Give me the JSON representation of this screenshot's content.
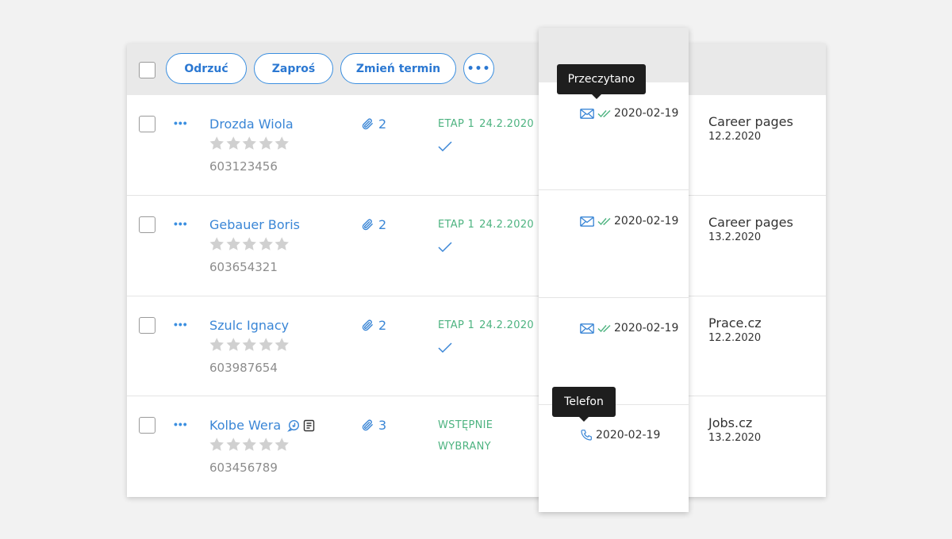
{
  "toolbar": {
    "buttons": [
      {
        "label": "Odrzuć"
      },
      {
        "label": "Zaproś"
      },
      {
        "label": "Zmień termin"
      }
    ],
    "more_label": "•••"
  },
  "row_menu_label": "•••",
  "rows": [
    {
      "name": "Drozda Wiola",
      "rating": 0,
      "phone": "603123456",
      "attachments": "2",
      "stage": "ETAP 1",
      "stage_date": "24.2.2020",
      "stage_line2": "",
      "contact_date": "2020-02-19",
      "contact_type": "email-read",
      "source": "Career pages",
      "source_date": "12.2.2020"
    },
    {
      "name": "Gebauer Boris",
      "rating": 0,
      "phone": "603654321",
      "attachments": "2",
      "stage": "ETAP 1",
      "stage_date": "24.2.2020",
      "stage_line2": "",
      "contact_date": "2020-02-19",
      "contact_type": "email-read",
      "source": "Career pages",
      "source_date": "13.2.2020"
    },
    {
      "name": "Szulc Ignacy",
      "rating": 0,
      "phone": "603987654",
      "attachments": "2",
      "stage": "ETAP 1",
      "stage_date": "24.2.2020",
      "stage_line2": "",
      "contact_date": "2020-02-19",
      "contact_type": "email-read",
      "source": "Prace.cz",
      "source_date": "12.2.2020"
    },
    {
      "name": "Kolbe Wera",
      "rating": 0,
      "phone": "603456789",
      "attachments": "3",
      "stage": "WSTĘPNIE",
      "stage_date": "",
      "stage_line2": "WYBRANY",
      "contact_date": "2020-02-19",
      "contact_type": "phone",
      "source": "Jobs.cz",
      "source_date": "13.2.2020"
    }
  ],
  "tooltips": {
    "read": "Przeczytano",
    "phone": "Telefon"
  },
  "colors": {
    "accent": "#3b8fe0",
    "stage_green": "#4db380",
    "star_empty": "#d0d0d0"
  }
}
